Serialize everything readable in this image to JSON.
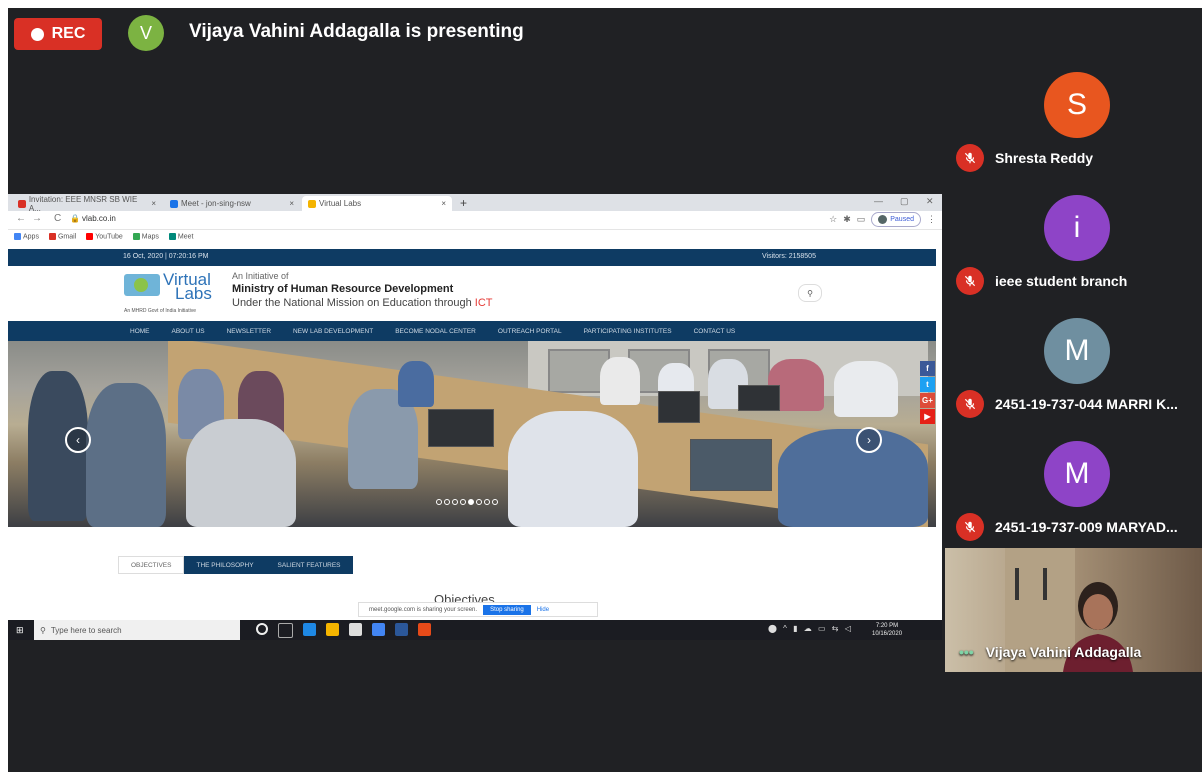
{
  "meeting": {
    "rec_label": "REC",
    "presenter_initial": "V",
    "presenting_text": "Vijaya Vahini Addagalla is presenting"
  },
  "browser": {
    "tabs": [
      {
        "label": "Invitation: EEE MNSR SB WIE A...",
        "color": "#d93025"
      },
      {
        "label": "Meet - jon-sing-nsw",
        "color": "#1a73e8"
      },
      {
        "label": "Virtual Labs",
        "color": "#f4b400"
      }
    ],
    "new_tab": "+",
    "url": "vlab.co.in",
    "profile": "Paused",
    "bookmarks": [
      "Apps",
      "Gmail",
      "YouTube",
      "Maps",
      "Meet"
    ]
  },
  "site": {
    "date": "16 Oct, 2020 | 07:20:16 PM",
    "visitors": "Visitors: 2158505",
    "logo_virtual": "Virtual",
    "logo_labs": "Labs",
    "logo_tagline": "An MHRD Govt of India Initiative",
    "initiative": "An Initiative of",
    "ministry": "Ministry of Human Resource Development",
    "mission": "Under the National Mission on Education through",
    "mission_accent": "ICT",
    "menu": [
      "HOME",
      "ABOUT US",
      "NEWSLETTER",
      "NEW LAB DEVELOPMENT",
      "BECOME NODAL CENTER",
      "OUTREACH PORTAL",
      "PARTICIPATING INSTITUTES",
      "CONTACT US"
    ],
    "social": [
      "f",
      "t",
      "G+",
      "▶"
    ],
    "content_tabs": [
      "OBJECTIVES",
      "THE PHILOSOPHY",
      "SALIENT FEATURES"
    ],
    "section_heading": "Objectives",
    "slide_count": 8,
    "active_slide": 5
  },
  "share_bar": {
    "text": "meet.google.com is sharing your screen.",
    "stop_label": "Stop sharing",
    "hide_label": "Hide"
  },
  "taskbar": {
    "search_placeholder": "Type here to search",
    "time": "7:20 PM",
    "date": "10/16/2020"
  },
  "participants": [
    {
      "initial": "S",
      "name": "Shresta Reddy",
      "color": "#e8561f"
    },
    {
      "initial": "i",
      "name": "ieee student branch",
      "color": "#8e44c7"
    },
    {
      "initial": "M",
      "name": "2451-19-737-044 MARRI K...",
      "color": "#6f8fa0"
    },
    {
      "initial": "M",
      "name": "2451-19-737-009 MARYAD...",
      "color": "#8e44c7"
    }
  ],
  "self": {
    "more_label": "•••",
    "name": "Vijaya Vahini Addagalla"
  },
  "colors": {
    "rec": "#d93025",
    "meet_bg": "#202124",
    "site_navy": "#0e3b63",
    "mute_red": "#d93025"
  }
}
